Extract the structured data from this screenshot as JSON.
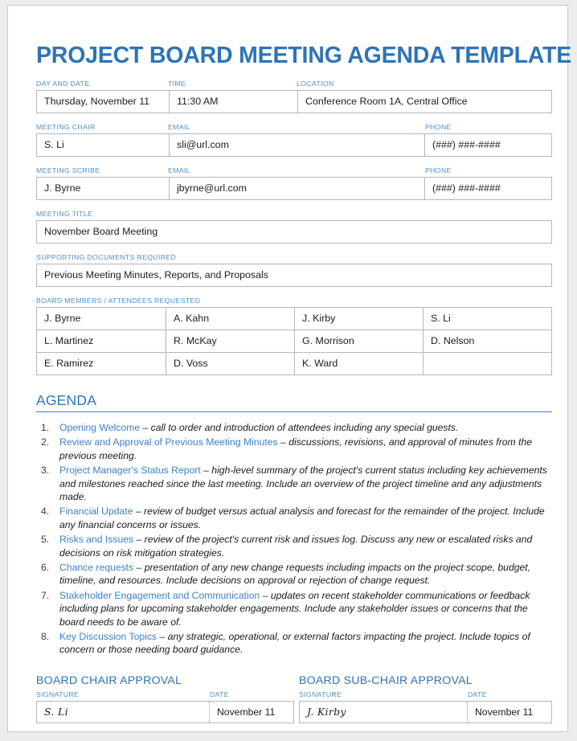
{
  "document": {
    "title": "PROJECT BOARD MEETING AGENDA TEMPLATE"
  },
  "colors": {
    "title_blue": "#2E74B5",
    "label_blue": "#4A90C8",
    "agenda_item_blue": "#3F80C4",
    "border_gray": "#B6B6B6",
    "body_text": "#1A1A1A",
    "page_background": "#ECECED"
  },
  "meeting_info": {
    "labels": {
      "day_and_date": "DAY AND DATE",
      "time": "TIME",
      "location": "LOCATION"
    },
    "values": {
      "day_and_date": "Thursday, November 11",
      "time": "11:30 AM",
      "location": "Conference Room 1A, Central Office"
    }
  },
  "meeting_chair": {
    "labels": {
      "name": "MEETING CHAIR",
      "email": "EMAIL",
      "phone": "PHONE"
    },
    "values": {
      "name": "S. Li",
      "email": "sli@url.com",
      "phone": "(###) ###-####"
    }
  },
  "meeting_scribe": {
    "labels": {
      "name": "MEETING SCRIBE",
      "email": "EMAIL",
      "phone": "PHONE"
    },
    "values": {
      "name": "J. Byrne",
      "email": "jbyrne@url.com",
      "phone": "(###) ###-####"
    }
  },
  "meeting_title": {
    "label": "MEETING TITLE",
    "value": "November Board Meeting"
  },
  "supporting_documents": {
    "label": "SUPPORTING DOCUMENTS REQUIRED",
    "value": "Previous Meeting Minutes, Reports, and Proposals"
  },
  "attendees": {
    "label": "BOARD MEMBERS / ATTENDEES REQUESTED",
    "rows": [
      [
        "J. Byrne",
        "A. Kahn",
        "J. Kirby",
        "S. Li"
      ],
      [
        "L. Martinez",
        "R. McKay",
        "G. Morrison",
        "D. Nelson"
      ],
      [
        "E. Ramirez",
        "D. Voss",
        "K. Ward",
        ""
      ]
    ]
  },
  "agenda": {
    "heading": "AGENDA",
    "items": [
      {
        "title": "Opening Welcome",
        "description": " – call to order and introduction of attendees including any special guests."
      },
      {
        "title": "Review and Approval of Previous Meeting Minutes",
        "description": " – discussions, revisions, and approval of minutes from the previous meeting."
      },
      {
        "title": "Project Manager's Status Report",
        "description": " – high-level summary of the project's current status including key achievements and milestones reached since the last meeting. Include an overview of the project timeline and any adjustments made."
      },
      {
        "title": "Financial Update",
        "description": " – review of budget versus actual analysis and forecast for the remainder of the project. Include any financial concerns or issues."
      },
      {
        "title": "Risks and Issues",
        "description": " – review of the project's current risk and issues log. Discuss any new or escalated risks and decisions on risk mitigation strategies."
      },
      {
        "title": "Chance requests",
        "description": " – presentation of any new change requests including impacts on the project scope, budget, timeline, and resources. Include decisions on approval or rejection of change request."
      },
      {
        "title": "Stakeholder Engagement and Communication",
        "description": " – updates on recent stakeholder communications or feedback including plans for upcoming stakeholder engagements. Include any stakeholder issues or concerns that the board needs to be aware of."
      },
      {
        "title": "Key Discussion Topics",
        "description": " – any strategic, operational, or external factors impacting the project. Include topics of concern or those needing board guidance."
      }
    ]
  },
  "approvals": {
    "chair": {
      "heading": "BOARD CHAIR APPROVAL",
      "signature_label": "SIGNATURE",
      "date_label": "DATE",
      "signature_value": "S. Li",
      "date_value": "November 11"
    },
    "sub_chair": {
      "heading": "BOARD SUB-CHAIR APPROVAL",
      "signature_label": "SIGNATURE",
      "date_label": "DATE",
      "signature_value": "J. Kirby",
      "date_value": "November 11"
    }
  }
}
